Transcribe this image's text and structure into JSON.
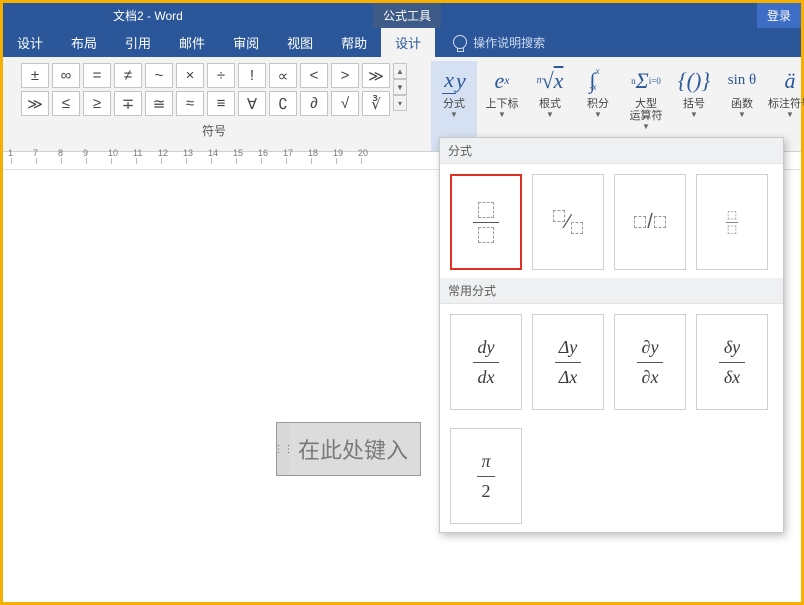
{
  "title": "文档2 - Word",
  "tools_badge": "公式工具",
  "login": "登录",
  "tabs": [
    "设计",
    "布局",
    "引用",
    "邮件",
    "审阅",
    "视图",
    "帮助",
    "设计"
  ],
  "active_tab_index": 7,
  "tell_me": "操作说明搜索",
  "symbols_row1": [
    "±",
    "∞",
    "=",
    "≠",
    "~",
    "×",
    "÷",
    "!",
    "∝",
    "<",
    ">",
    "≫"
  ],
  "symbols_row2": [
    "≫",
    "≤",
    "≥",
    "∓",
    "≅",
    "≈",
    "≡",
    "∀",
    "∁",
    "∂",
    "√",
    "∛"
  ],
  "symbols_group_label": "符号",
  "structures": [
    {
      "label": "分式",
      "icon": "x/y"
    },
    {
      "label": "上下标",
      "icon": "e^x"
    },
    {
      "label": "根式",
      "icon": "n√x"
    },
    {
      "label": "积分",
      "icon": "∫"
    },
    {
      "label": "大型\n运算符",
      "icon": "Σ"
    },
    {
      "label": "括号",
      "icon": "{()}"
    },
    {
      "label": "函数",
      "icon": "sinθ"
    },
    {
      "label": "标注符号",
      "icon": "ä"
    }
  ],
  "ruler_numbers": [
    "1",
    "7",
    "8",
    "9",
    "10",
    "11",
    "12",
    "13",
    "14",
    "15",
    "16",
    "17",
    "18",
    "19",
    "20"
  ],
  "eq_placeholder_text": "在此处键入",
  "dropdown": {
    "section1": "分式",
    "section2": "常用分式",
    "row2": [
      {
        "top": "dy",
        "bot": "dx"
      },
      {
        "top": "Δy",
        "bot": "Δx"
      },
      {
        "top": "∂y",
        "bot": "∂x"
      },
      {
        "top": "δy",
        "bot": "δx"
      }
    ],
    "row3": [
      {
        "top": "π",
        "bot": "2"
      }
    ]
  }
}
